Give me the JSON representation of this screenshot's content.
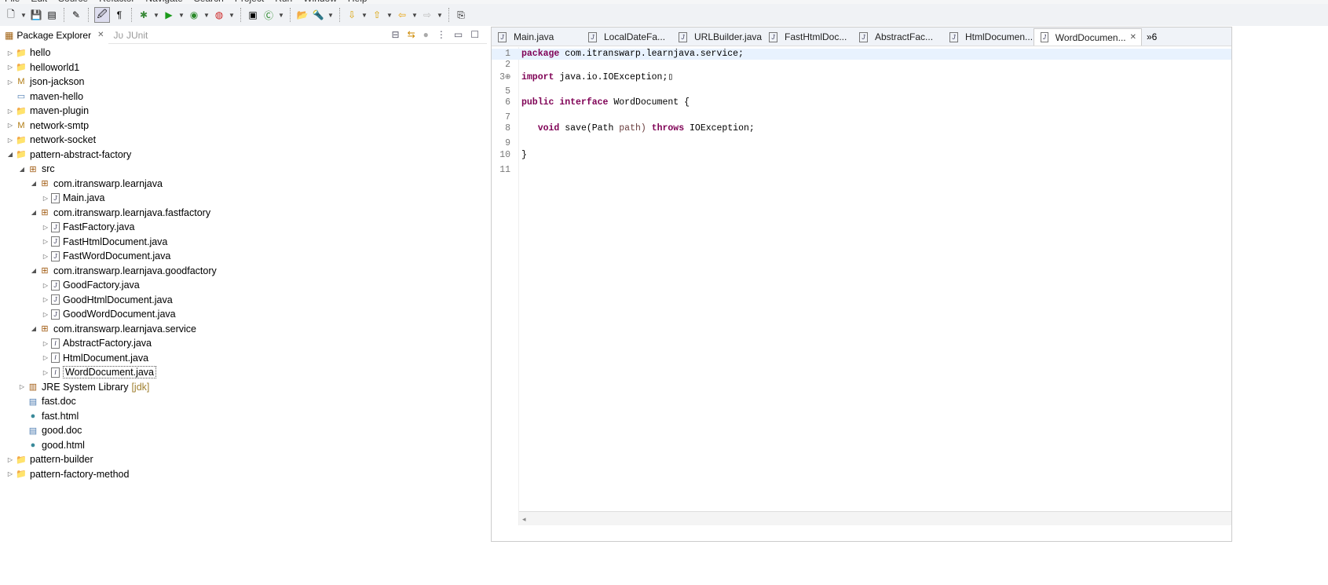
{
  "menu": [
    "File",
    "Edit",
    "Source",
    "Refactor",
    "Navigate",
    "Search",
    "Project",
    "Run",
    "Window",
    "Help"
  ],
  "toolbar_icons": [
    "new-icon",
    "save-icon",
    "save-all-icon",
    "toggle-breakpoint-icon",
    "open-type-icon",
    "mark-occurrences-icon",
    "debug-icon",
    "run-icon",
    "coverage-icon",
    "external-tools-icon",
    "new-java-project-icon",
    "new-class-icon",
    "open-folder-icon",
    "search-icon",
    "next-annotation-icon",
    "prev-annotation-icon",
    "back-icon",
    "forward-icon",
    "pin-editor-icon"
  ],
  "left_panel": {
    "tabs": [
      {
        "label": "Package Explorer",
        "active": true
      },
      {
        "label": "JUnit",
        "active": false
      }
    ],
    "tree": [
      {
        "label": "hello",
        "level": 0,
        "icon": "project",
        "expanded": false
      },
      {
        "label": "helloworld1",
        "level": 0,
        "icon": "project",
        "expanded": false
      },
      {
        "label": "json-jackson",
        "level": 0,
        "icon": "maven-project",
        "expanded": false
      },
      {
        "label": "maven-hello",
        "level": 0,
        "icon": "folder",
        "expanded": null
      },
      {
        "label": "maven-plugin",
        "level": 0,
        "icon": "project",
        "expanded": false
      },
      {
        "label": "network-smtp",
        "level": 0,
        "icon": "maven-project",
        "expanded": false
      },
      {
        "label": "network-socket",
        "level": 0,
        "icon": "project",
        "expanded": false
      },
      {
        "label": "pattern-abstract-factory",
        "level": 0,
        "icon": "project",
        "expanded": true
      },
      {
        "label": "src",
        "level": 1,
        "icon": "source-folder",
        "expanded": true
      },
      {
        "label": "com.itranswarp.learnjava",
        "level": 2,
        "icon": "package",
        "expanded": true
      },
      {
        "label": "Main.java",
        "level": 3,
        "icon": "java-file",
        "expanded": false
      },
      {
        "label": "com.itranswarp.learnjava.fastfactory",
        "level": 2,
        "icon": "package",
        "expanded": true
      },
      {
        "label": "FastFactory.java",
        "level": 3,
        "icon": "java-file",
        "expanded": false
      },
      {
        "label": "FastHtmlDocument.java",
        "level": 3,
        "icon": "java-file",
        "expanded": false
      },
      {
        "label": "FastWordDocument.java",
        "level": 3,
        "icon": "java-file",
        "expanded": false
      },
      {
        "label": "com.itranswarp.learnjava.goodfactory",
        "level": 2,
        "icon": "package",
        "expanded": true
      },
      {
        "label": "GoodFactory.java",
        "level": 3,
        "icon": "java-file",
        "expanded": false
      },
      {
        "label": "GoodHtmlDocument.java",
        "level": 3,
        "icon": "java-file",
        "expanded": false
      },
      {
        "label": "GoodWordDocument.java",
        "level": 3,
        "icon": "java-file",
        "expanded": false
      },
      {
        "label": "com.itranswarp.learnjava.service",
        "level": 2,
        "icon": "package",
        "expanded": true
      },
      {
        "label": "AbstractFactory.java",
        "level": 3,
        "icon": "java-interface",
        "expanded": false
      },
      {
        "label": "HtmlDocument.java",
        "level": 3,
        "icon": "java-interface",
        "expanded": false
      },
      {
        "label": "WordDocument.java",
        "level": 3,
        "icon": "java-interface",
        "expanded": false,
        "selected": true
      },
      {
        "label": "JRE System Library",
        "decoration": "[jdk]",
        "level": 1,
        "icon": "library",
        "expanded": false
      },
      {
        "label": "fast.doc",
        "level": 1,
        "icon": "doc-file",
        "expanded": null
      },
      {
        "label": "fast.html",
        "level": 1,
        "icon": "html-file",
        "expanded": null
      },
      {
        "label": "good.doc",
        "level": 1,
        "icon": "doc-file",
        "expanded": null
      },
      {
        "label": "good.html",
        "level": 1,
        "icon": "html-file",
        "expanded": null
      },
      {
        "label": "pattern-builder",
        "level": 0,
        "icon": "project",
        "expanded": false
      },
      {
        "label": "pattern-factory-method",
        "level": 0,
        "icon": "project",
        "expanded": false
      }
    ]
  },
  "editor": {
    "tabs": [
      {
        "label": "Main.java"
      },
      {
        "label": "LocalDateFa..."
      },
      {
        "label": "URLBuilder.java"
      },
      {
        "label": "FastHtmlDoc..."
      },
      {
        "label": "AbstractFac..."
      },
      {
        "label": "HtmlDocumen..."
      },
      {
        "label": "WordDocumen...",
        "active": true
      }
    ],
    "overflow_count": "»6",
    "lines": [
      {
        "n": "1",
        "tokens": [
          [
            "kw",
            "package"
          ],
          [
            "",
            "com.itranswarp.learnjava.service;"
          ]
        ]
      },
      {
        "n": "2",
        "tokens": []
      },
      {
        "n": "3⊕",
        "tokens": [
          [
            "kw",
            "import"
          ],
          [
            "",
            "java.io.IOException;"
          ],
          [
            "",
            "▯"
          ]
        ]
      },
      {
        "n": "5",
        "tokens": []
      },
      {
        "n": "6",
        "tokens": [
          [
            "kw",
            "public"
          ],
          [
            "kw",
            "interface"
          ],
          [
            "",
            "WordDocument {"
          ]
        ]
      },
      {
        "n": "7",
        "tokens": []
      },
      {
        "n": "8",
        "tokens": [
          [
            "",
            "   "
          ],
          [
            "kw",
            "void"
          ],
          [
            "",
            "save(Path"
          ],
          [
            "var",
            "path)"
          ],
          [
            "kw",
            "throws"
          ],
          [
            "",
            "IOException;"
          ]
        ]
      },
      {
        "n": "9",
        "tokens": []
      },
      {
        "n": "10",
        "tokens": [
          [
            "",
            "}"
          ]
        ]
      },
      {
        "n": "11",
        "tokens": []
      }
    ]
  }
}
